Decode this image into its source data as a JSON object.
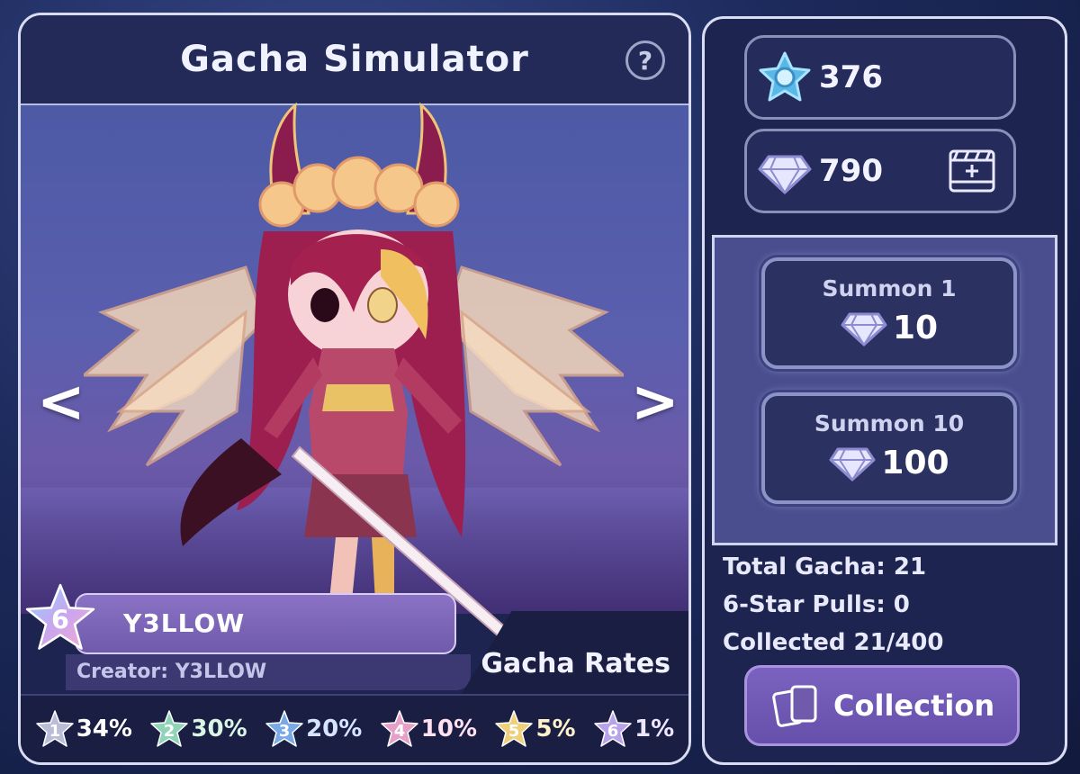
{
  "header": {
    "title": "Gacha Simulator",
    "help_icon": "?"
  },
  "character": {
    "name": "Y3LLOW",
    "creator": "Creator: Y3LLOW",
    "rarity": "6"
  },
  "navigation": {
    "prev": "<",
    "next": ">"
  },
  "gacha_rates_label": "Gacha Rates",
  "rates": [
    {
      "star": "1",
      "pct": "34%",
      "color": "#b9bdd6",
      "text_color": "#ffffff"
    },
    {
      "star": "2",
      "pct": "30%",
      "color": "#8fd4b6",
      "text_color": "#d9f5e6"
    },
    {
      "star": "3",
      "pct": "20%",
      "color": "#79a9e6",
      "text_color": "#d6e5ff"
    },
    {
      "star": "4",
      "pct": "10%",
      "color": "#e6a0c8",
      "text_color": "#ffe2f1"
    },
    {
      "star": "5",
      "pct": "5%",
      "color": "#f0cf7a",
      "text_color": "#fff2c9"
    },
    {
      "star": "6",
      "pct": "1%",
      "color": "#b8a2ea",
      "text_color": "#eee6ff"
    }
  ],
  "currency": {
    "stars": "376",
    "gems": "790"
  },
  "summon": {
    "one": {
      "label": "Summon 1",
      "cost": "10"
    },
    "ten": {
      "label": "Summon 10",
      "cost": "100"
    }
  },
  "stats": {
    "total": "Total Gacha: 21",
    "six_star": "6-Star Pulls: 0",
    "collected": "Collected 21/400"
  },
  "collection_button": "Collection",
  "colors": {
    "accent": "#6f5aab",
    "panel": "#1e2450",
    "border": "#d9dcf2"
  }
}
